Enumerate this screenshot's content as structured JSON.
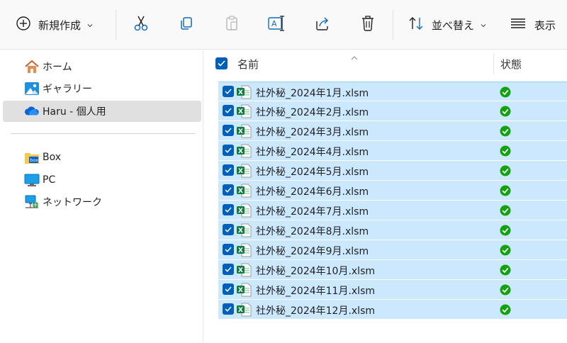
{
  "toolbar": {
    "new_label": "新規作成",
    "sort_label": "並べ替え",
    "view_label": "表示"
  },
  "sidebar": {
    "items": [
      {
        "label": "ホーム",
        "icon": "home-icon"
      },
      {
        "label": "ギャラリー",
        "icon": "gallery-icon"
      },
      {
        "label": "Haru - 個人用",
        "icon": "onedrive-cloud-icon",
        "selected": true
      },
      {
        "label": "Box",
        "icon": "box-folder-icon"
      },
      {
        "label": "PC",
        "icon": "pc-monitor-icon"
      },
      {
        "label": "ネットワーク",
        "icon": "network-icon"
      }
    ]
  },
  "list": {
    "col_name": "名前",
    "col_status": "状態",
    "files": [
      {
        "name": "社外秘_2024年1月.xlsm",
        "status": "synced"
      },
      {
        "name": "社外秘_2024年2月.xlsm",
        "status": "synced"
      },
      {
        "name": "社外秘_2024年3月.xlsm",
        "status": "synced"
      },
      {
        "name": "社外秘_2024年4月.xlsm",
        "status": "synced"
      },
      {
        "name": "社外秘_2024年5月.xlsm",
        "status": "synced"
      },
      {
        "name": "社外秘_2024年6月.xlsm",
        "status": "synced"
      },
      {
        "name": "社外秘_2024年7月.xlsm",
        "status": "synced"
      },
      {
        "name": "社外秘_2024年8月.xlsm",
        "status": "synced"
      },
      {
        "name": "社外秘_2024年9月.xlsm",
        "status": "synced"
      },
      {
        "name": "社外秘_2024年10月.xlsm",
        "status": "synced"
      },
      {
        "name": "社外秘_2024年11月.xlsm",
        "status": "synced"
      },
      {
        "name": "社外秘_2024年12月.xlsm",
        "status": "synced"
      }
    ]
  },
  "colors": {
    "accent": "#005fb8",
    "selection": "#cce8ff",
    "excel_green": "#107c41",
    "status_green": "#13a10e"
  }
}
